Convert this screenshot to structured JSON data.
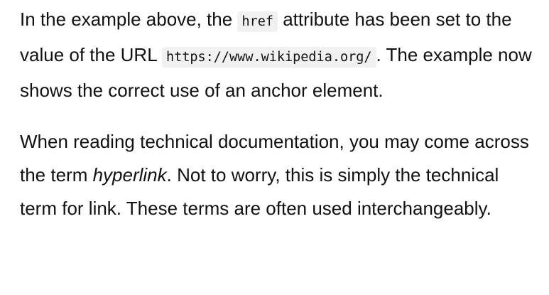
{
  "article": {
    "paragraph1": {
      "text_a": "In the example above, the ",
      "code_a": "href",
      "text_b": " attribute has been set to the value of the URL ",
      "code_b": "https://www.wikipedia.org/",
      "text_c": ". The example now shows the correct use of an anchor element."
    },
    "paragraph2": {
      "text_a": "When reading technical documentation, you may come across the term ",
      "emphasis": "hyperlink",
      "text_b": ". Not to worry, this is simply the technical term for link. These terms are often used interchangeably."
    }
  }
}
